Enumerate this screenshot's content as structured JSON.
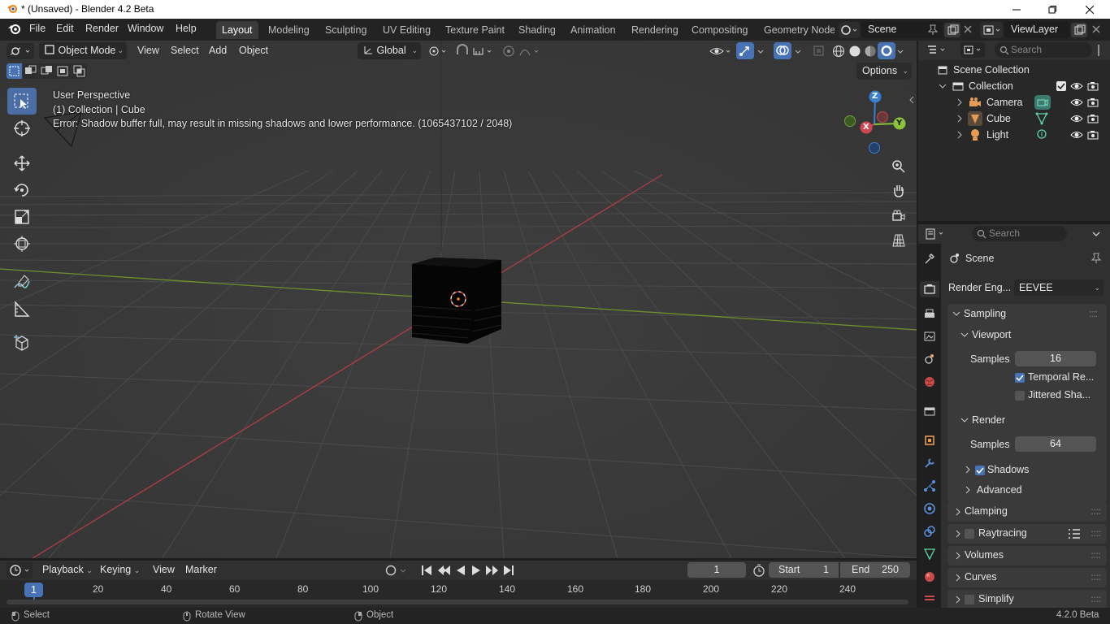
{
  "window": {
    "title": "* (Unsaved) - Blender 4.2 Beta"
  },
  "menu": [
    "File",
    "Edit",
    "Render",
    "Window",
    "Help"
  ],
  "workspaces": [
    "Layout",
    "Modeling",
    "Sculpting",
    "UV Editing",
    "Texture Paint",
    "Shading",
    "Animation",
    "Rendering",
    "Compositing",
    "Geometry Node"
  ],
  "scene_field": "Scene",
  "viewlayer_field": "ViewLayer",
  "viewport_header": {
    "mode": "Object Mode",
    "menus": [
      "View",
      "Select",
      "Add",
      "Object"
    ],
    "orientation": "Global",
    "options_label": "Options"
  },
  "overlay": {
    "line1": "User Perspective",
    "line2": "(1) Collection | Cube",
    "error": "Error: Shadow buffer full, may result in missing shadows and lower performance. (1065437102 / 2048)"
  },
  "gizmo": {
    "x": "X",
    "y": "Y",
    "z": "Z"
  },
  "outliner": {
    "search_placeholder": "Search",
    "root": "Scene Collection",
    "collection": "Collection",
    "items": [
      "Camera",
      "Cube",
      "Light"
    ]
  },
  "properties": {
    "search_placeholder": "Search",
    "breadcrumb": "Scene",
    "render_engine_label": "Render Eng...",
    "render_engine_value": "EEVEE",
    "sampling": "Sampling",
    "viewport": "Viewport",
    "samples_label": "Samples",
    "viewport_samples": "16",
    "temporal": "Temporal Re...",
    "temporal_checked": true,
    "jittered": "Jittered Sha...",
    "jittered_checked": false,
    "render": "Render",
    "render_samples": "64",
    "shadows": "Shadows",
    "advanced": "Advanced",
    "clamping": "Clamping",
    "raytracing": "Raytracing",
    "volumes": "Volumes",
    "curves": "Curves",
    "simplify": "Simplify"
  },
  "timeline": {
    "menus": [
      "Playback",
      "Keying",
      "View",
      "Marker"
    ],
    "current_frame": "1",
    "start_label": "Start",
    "start": "1",
    "end_label": "End",
    "end": "250",
    "ticks": [
      "1",
      "20",
      "40",
      "60",
      "80",
      "100",
      "120",
      "140",
      "160",
      "180",
      "200",
      "220",
      "240"
    ]
  },
  "statusbar": {
    "select": "Select",
    "rotate": "Rotate View",
    "object": "Object",
    "version": "4.2.0 Beta"
  },
  "colors": {
    "accent": "#4772b3",
    "x_axis": "#d14750",
    "y_axis": "#8bc43a",
    "z_axis": "#3a7ed0"
  }
}
